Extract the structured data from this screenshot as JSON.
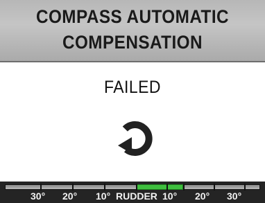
{
  "header": {
    "title_line1": "COMPASS AUTOMATIC",
    "title_line2": "COMPENSATION"
  },
  "main": {
    "status": "FAILED",
    "icon": "retry-circular-arrow-icon"
  },
  "rudder": {
    "label": "RUDDER",
    "scale_left": [
      "30°",
      "20°",
      "10°"
    ],
    "scale_right": [
      "10°",
      "20°",
      "30°"
    ],
    "indicator_color": "#3fbf3f"
  },
  "colors": {
    "title_bg": "#b7b7b7",
    "body_bg": "#ffffff",
    "rudder_bg": "#242424"
  }
}
